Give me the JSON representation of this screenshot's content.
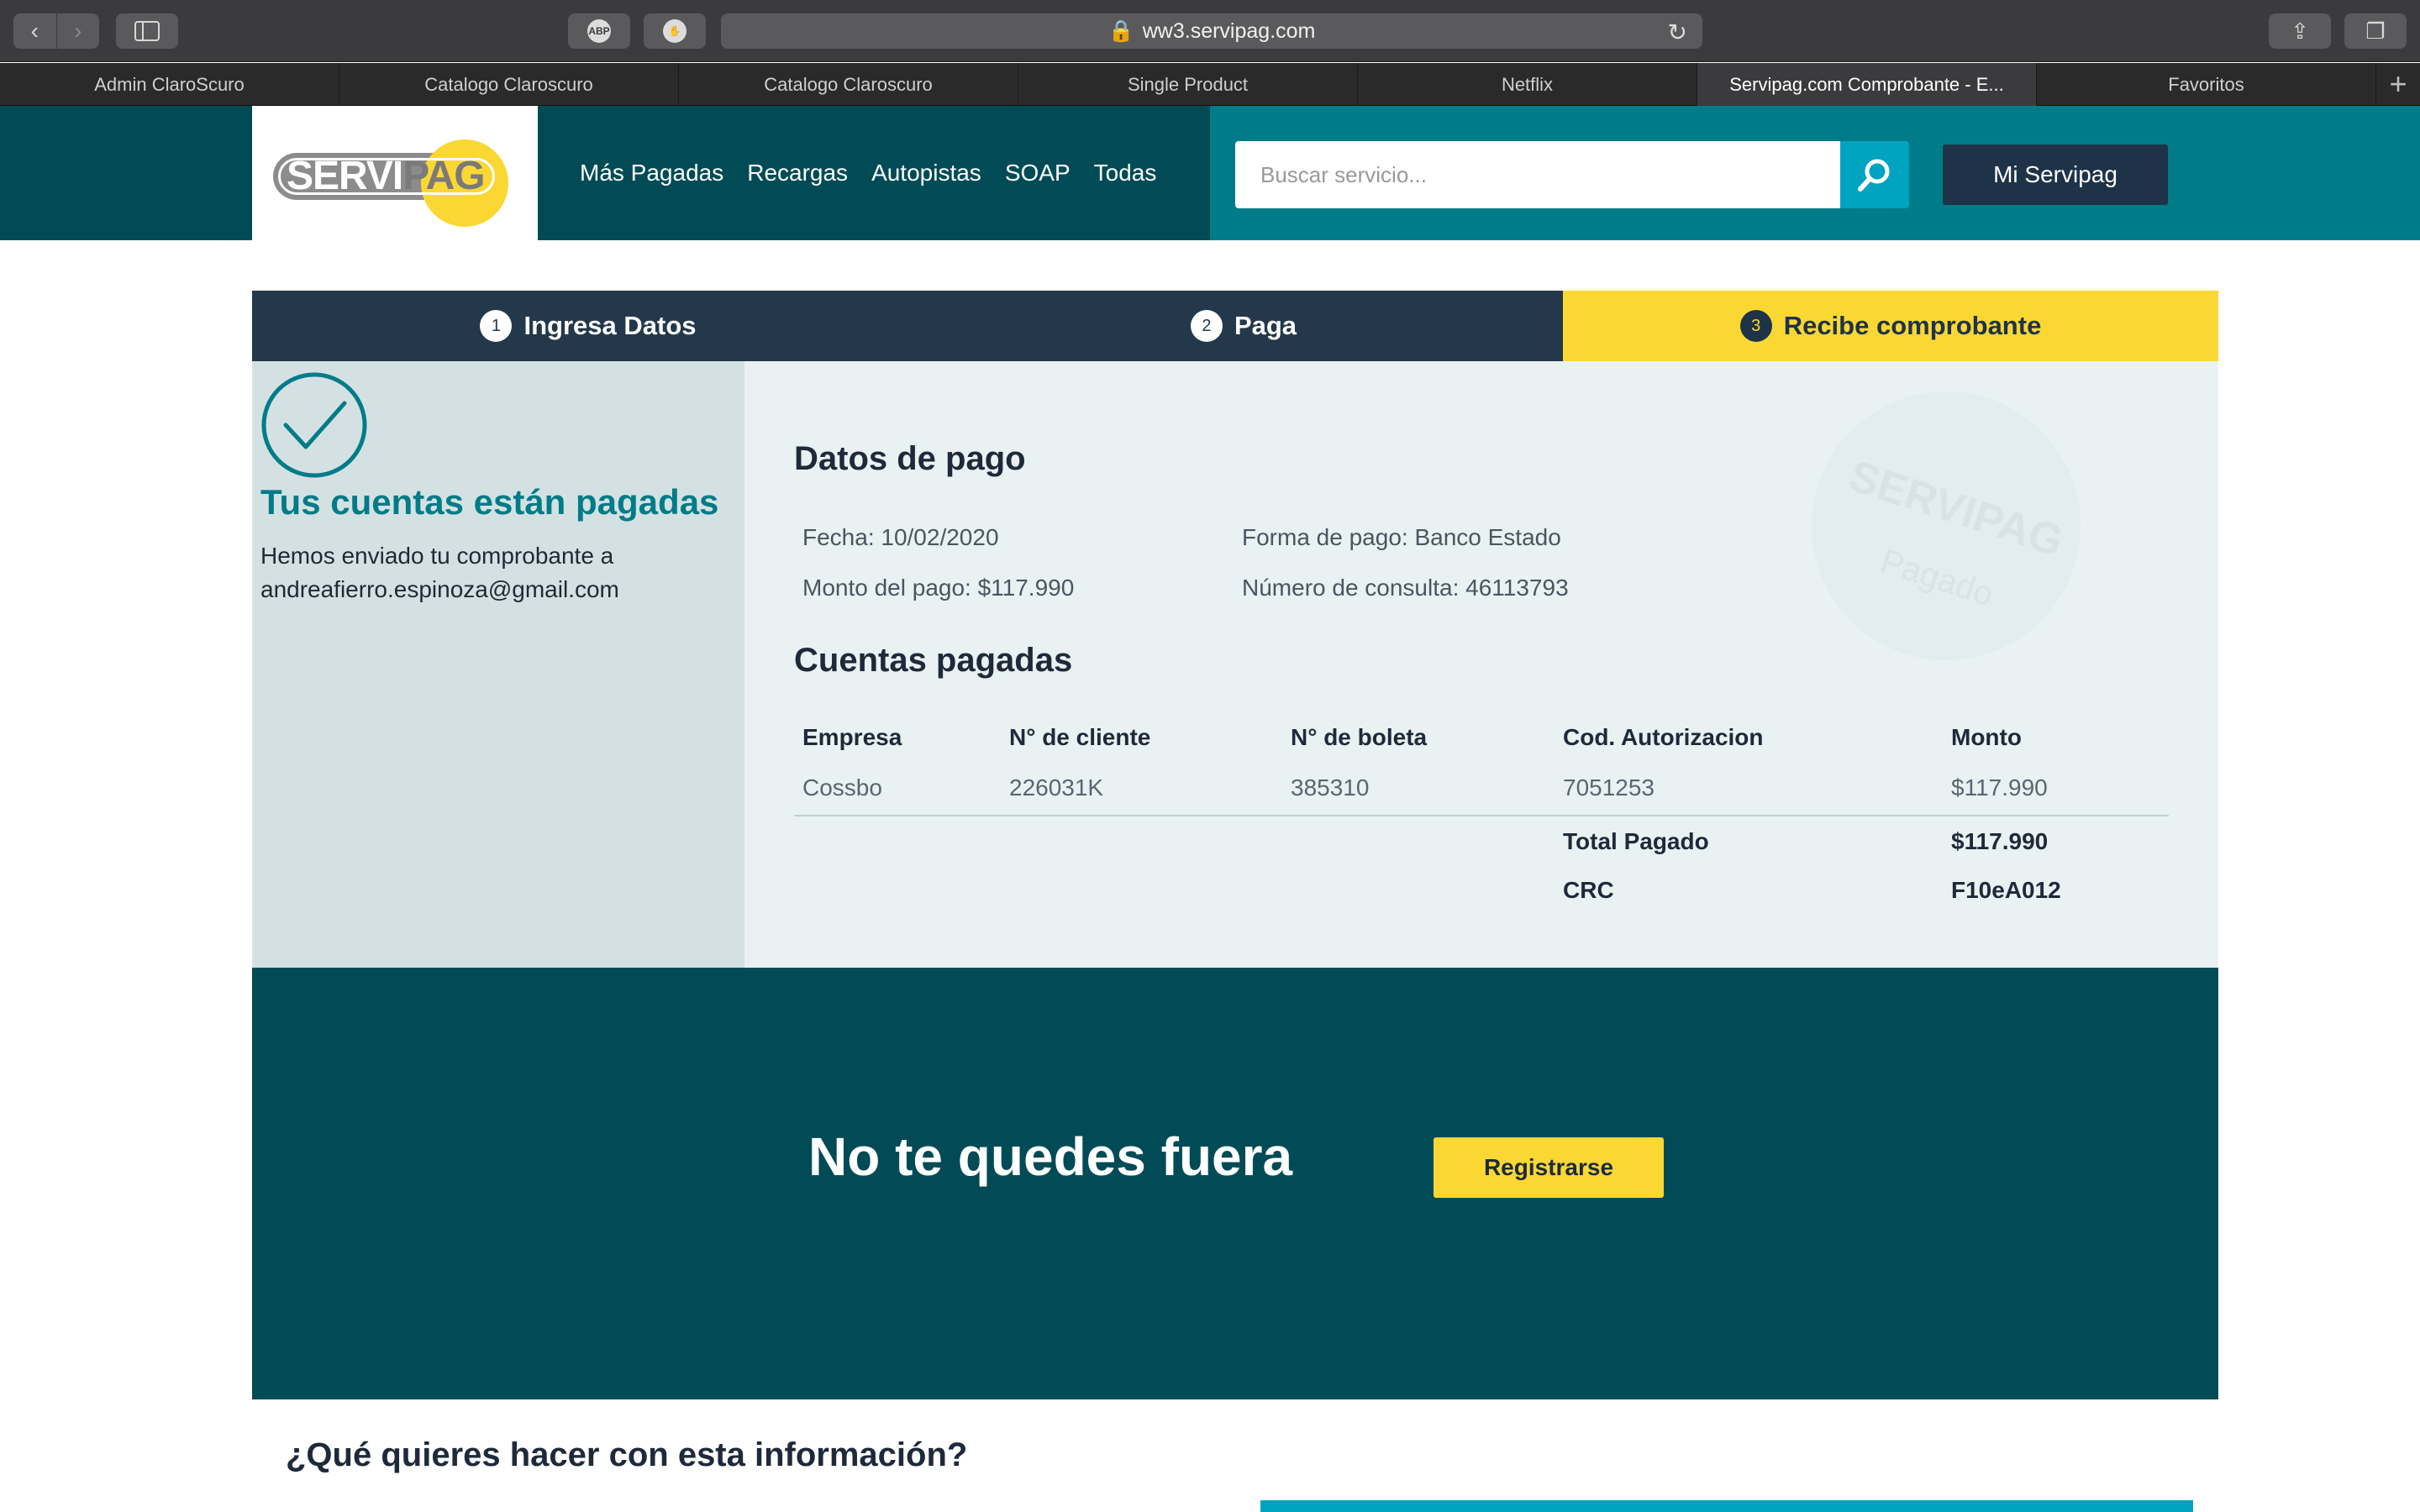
{
  "browser": {
    "url": "ww3.servipag.com",
    "tabs": [
      {
        "label": "Admin ClaroScuro"
      },
      {
        "label": "Catalogo Claroscuro"
      },
      {
        "label": "Catalogo Claroscuro"
      },
      {
        "label": "Single Product"
      },
      {
        "label": "Netflix"
      },
      {
        "label": "Servipag.com Comprobante - E..."
      },
      {
        "label": "Favoritos"
      }
    ],
    "active_tab": 5
  },
  "header": {
    "logo_left": "SERVI",
    "logo_right": "PAG",
    "nav": [
      "Más Pagadas",
      "Recargas",
      "Autopistas",
      "SOAP",
      "Todas"
    ],
    "search_placeholder": "Buscar servicio...",
    "account_button": "Mi Servipag"
  },
  "steps": [
    {
      "num": "1",
      "label": "Ingresa Datos"
    },
    {
      "num": "2",
      "label": "Paga"
    },
    {
      "num": "3",
      "label": "Recibe comprobante"
    }
  ],
  "result": {
    "title": "Tus cuentas están pagadas",
    "message_line1": "Hemos enviado tu comprobante a",
    "email": "andreafierro.espinoza@gmail.com"
  },
  "payment": {
    "heading": "Datos de pago",
    "fecha": "Fecha: 10/02/2020",
    "forma": "Forma de pago: Banco Estado",
    "monto": "Monto del pago: $117.990",
    "consulta": "Número de consulta: 46113793",
    "stamp_brand": "SERVIPAG",
    "stamp_status": "Pagado"
  },
  "accounts": {
    "heading": "Cuentas pagadas",
    "columns": [
      "Empresa",
      "N° de cliente",
      "N° de boleta",
      "Cod. Autorizacion",
      "Monto"
    ],
    "rows": [
      [
        "Cossbo",
        "226031K",
        "385310",
        "7051253",
        "$117.990"
      ]
    ],
    "total_label": "Total Pagado",
    "total_value": "$117.990",
    "crc_label": "CRC",
    "crc_value": "F10eA012"
  },
  "promo": {
    "title": "No te quedes fuera",
    "button": "Registrarse"
  },
  "footer_question": "¿Qué quieres hacer con esta información?",
  "colors": {
    "brand_dark": "#004b55",
    "brand_teal": "#007c88",
    "accent_yellow": "#fbd734",
    "navy": "#23384a",
    "search_blue": "#00a3c0"
  }
}
